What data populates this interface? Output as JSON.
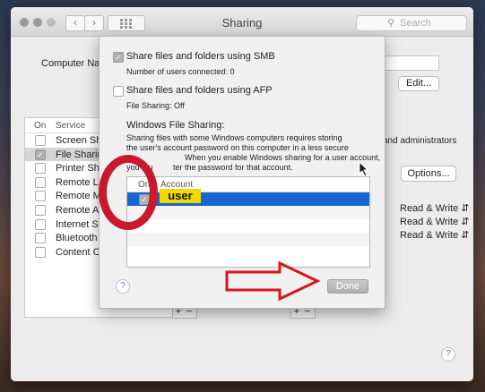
{
  "window": {
    "title": "Sharing",
    "search_placeholder": "Search"
  },
  "behind": {
    "computer_name_label": "Computer Na",
    "edit_button": "Edit...",
    "admins_text": "and administrators",
    "options_button": "Options...",
    "services_header": {
      "on": "On",
      "service": "Service"
    },
    "services": [
      {
        "label": "Screen Sha",
        "on": false,
        "selected": false
      },
      {
        "label": "File Sharing",
        "on": true,
        "selected": true
      },
      {
        "label": "Printer Sha",
        "on": false,
        "selected": false
      },
      {
        "label": "Remote Lo",
        "on": false,
        "selected": false
      },
      {
        "label": "Remote M",
        "on": false,
        "selected": false
      },
      {
        "label": "Remote Ap",
        "on": false,
        "selected": false
      },
      {
        "label": "Internet Sh",
        "on": false,
        "selected": false
      },
      {
        "label": "Bluetooth S",
        "on": false,
        "selected": false
      },
      {
        "label": "Content Ca",
        "on": false,
        "selected": false
      }
    ],
    "permissions": [
      "Read & Write",
      "Read & Write",
      "Read & Write"
    ],
    "plus": "+",
    "minus": "−",
    "help": "?"
  },
  "dialog": {
    "smb_checkbox_label": "Share files and folders using SMB",
    "smb_checked": true,
    "smb_users": "Number of users connected: 0",
    "afp_checkbox_label": "Share files and folders using AFP",
    "afp_checked": false,
    "afp_status": "File Sharing: Off",
    "windows_heading": "Windows File Sharing:",
    "windows_desc_1": "Sharing files with some Windows computers requires storing",
    "windows_desc_2": "the user's account password on this computer in a less secure",
    "windows_desc_3": "When you enable Windows sharing for a user account,",
    "windows_desc_4a": "you mu",
    "windows_desc_4b": "ter the password for that account.",
    "accounts_header": {
      "on": "On",
      "account": "Account"
    },
    "accounts": [
      {
        "on": true,
        "name": "user"
      }
    ],
    "help": "?",
    "done_button": "Done"
  },
  "annotations": {
    "circle_color": "#c8192e",
    "arrow_color": "#d8141e",
    "user_tag": "user",
    "user_tag_color": "#f0d800"
  },
  "colors": {
    "selection": "#1866cf"
  }
}
